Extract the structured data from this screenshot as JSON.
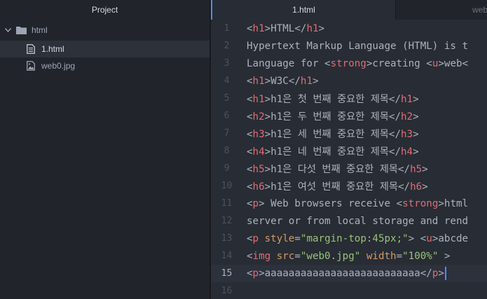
{
  "sidebar": {
    "title": "Project",
    "folder": "html",
    "files": [
      "1.html",
      "web0.jpg"
    ]
  },
  "tabs": [
    "1.html",
    "web"
  ],
  "editor": {
    "line_numbers": [
      "1",
      "2",
      "3",
      "4",
      "5",
      "6",
      "7",
      "8",
      "9",
      "10",
      "11",
      "12",
      "13",
      "14",
      "15",
      "16"
    ],
    "line1": {
      "t1": "h1",
      "text": "HTML",
      "t2": "h1"
    },
    "line2": {
      "text": "Hypertext Markup Language (HTML) is t"
    },
    "line3": {
      "pre": "Language for ",
      "t1": "strong",
      "mid": "creating ",
      "t2": "u",
      "post": "web"
    },
    "line4": {
      "t1": "h1",
      "text": "W3C",
      "t2": "h1"
    },
    "line5": {
      "t1": "h1",
      "text": "h1은 첫 번째 중요한 제목",
      "t2": "h1"
    },
    "line6": {
      "t1": "h2",
      "text": "h1은 두 번째 중요한 제목",
      "t2": "h2"
    },
    "line7": {
      "t1": "h3",
      "text": "h1은 세 번째 중요한 제목",
      "t2": "h3"
    },
    "line8": {
      "t1": "h4",
      "text": "h1은 네 번째 중요한 제목",
      "t2": "h4"
    },
    "line9": {
      "t1": "h5",
      "text": "h1은 다섯 번째 중요한 제목",
      "t2": "h5"
    },
    "line10": {
      "t1": "h6",
      "text": "h1은 여섯 번째 중요한 제목",
      "t2": "h6"
    },
    "line11": {
      "t1": "p",
      "mid": " Web browsers receive ",
      "t2": "strong",
      "post": "html"
    },
    "line12": {
      "text": "server or from local storage and rend"
    },
    "line13": {
      "t1": "p",
      "attr": "style",
      "val": "\"margin-top:45px;\"",
      "mid": " ",
      "t2": "u",
      "post": "abcde"
    },
    "line14": {
      "t1": "img",
      "attr1": "src",
      "val1": "\"web0.jpg\"",
      "attr2": "width",
      "val2": "\"100%\""
    },
    "line15": {
      "t1": "p",
      "text": "aaaaaaaaaaaaaaaaaaaaaaaaaa",
      "t2": "p"
    }
  },
  "colors": {
    "background": "#282c34",
    "sidebar": "#21252b",
    "tag": "#e06c75",
    "attribute": "#d19a66",
    "string": "#98c379",
    "text": "#abb2bf",
    "cursor": "#528bff"
  },
  "icons": [
    "chevron-down-icon",
    "folder-icon",
    "file-text-icon",
    "image-file-icon"
  ]
}
